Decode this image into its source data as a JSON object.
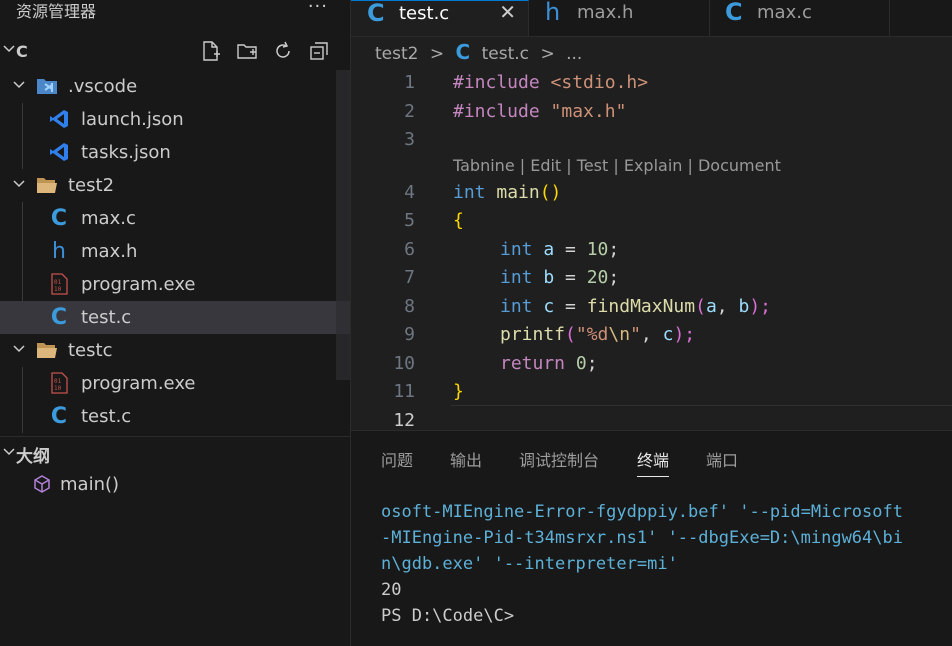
{
  "sidebar": {
    "title": "资源管理器",
    "more": "···",
    "workspace": "C",
    "tree": [
      {
        "label": ".vscode",
        "type": "folder-vscode",
        "depth": 0,
        "expanded": true
      },
      {
        "label": "launch.json",
        "type": "vscode-file",
        "depth": 1
      },
      {
        "label": "tasks.json",
        "type": "vscode-file",
        "depth": 1
      },
      {
        "label": "test2",
        "type": "folder",
        "depth": 0,
        "expanded": true
      },
      {
        "label": "max.c",
        "type": "c-file",
        "depth": 1
      },
      {
        "label": "max.h",
        "type": "h-file",
        "depth": 1
      },
      {
        "label": "program.exe",
        "type": "exe-file",
        "depth": 1
      },
      {
        "label": "test.c",
        "type": "c-file",
        "depth": 1,
        "selected": true
      },
      {
        "label": "testc",
        "type": "folder",
        "depth": 0,
        "expanded": true
      },
      {
        "label": "program.exe",
        "type": "exe-file",
        "depth": 1
      },
      {
        "label": "test.c",
        "type": "c-file",
        "depth": 1
      }
    ],
    "outline": {
      "title": "大纲",
      "items": [
        {
          "label": "main()"
        }
      ]
    }
  },
  "editor": {
    "tabs": [
      {
        "label": "test.c",
        "icon": "C",
        "active": true,
        "close": "✕"
      },
      {
        "label": "max.h",
        "icon": "h",
        "active": false
      },
      {
        "label": "max.c",
        "icon": "C",
        "active": false
      }
    ],
    "breadcrumb": {
      "folder": "test2",
      "sep": ">",
      "file": "test.c",
      "tail": "..."
    },
    "line_numbers": [
      "1",
      "2",
      "3",
      "4",
      "5",
      "6",
      "7",
      "8",
      "9",
      "10",
      "11",
      "12"
    ],
    "codelens": "Tabnine | Edit | Test | Explain | Document",
    "code": {
      "l1": {
        "a": "#include",
        "b": " ",
        "c": "<stdio.h>"
      },
      "l2": {
        "a": "#include",
        "b": " ",
        "c": "\"max.h\""
      },
      "l4": {
        "a": "int",
        "b": " ",
        "c": "main",
        "d": "()"
      },
      "l5": {
        "a": "{"
      },
      "l6": {
        "a": "int",
        "b": " ",
        "c": "a",
        "d": " = ",
        "e": "10",
        "f": ";"
      },
      "l7": {
        "a": "int",
        "b": " ",
        "c": "b",
        "d": " = ",
        "e": "20",
        "f": ";"
      },
      "l8": {
        "a": "int",
        "b": " ",
        "c": "c",
        "d": " = ",
        "e": "findMaxNum",
        "f": "(",
        "g": "a",
        "h": ", ",
        "i": "b",
        "j": ");"
      },
      "l9": {
        "a": "printf",
        "b": "(",
        "c": "\"%d",
        "d": "\\n",
        "e": "\"",
        "f": ", ",
        "g": "c",
        "h": ");"
      },
      "l10": {
        "a": "return",
        "b": " ",
        "c": "0",
        "d": ";"
      },
      "l11": {
        "a": "}"
      }
    }
  },
  "panel": {
    "tabs": [
      "问题",
      "输出",
      "调试控制台",
      "终端",
      "端口"
    ],
    "active_tab": "终端",
    "terminal": [
      "osoft-MIEngine-Error-fgydppiy.bef' '--pid=Microsoft",
      "-MIEngine-Pid-t34msrxr.ns1' '--dbgExe=D:\\mingw64\\bi",
      "n\\gdb.exe' '--interpreter=mi'",
      "20",
      "PS D:\\Code\\C>"
    ]
  },
  "colors": {
    "accent": "#0078d4",
    "c_icon": "#3b9bdc",
    "h_icon": "#a074c4",
    "folder": "#dcb67a",
    "vscode": "#2f80ed"
  }
}
